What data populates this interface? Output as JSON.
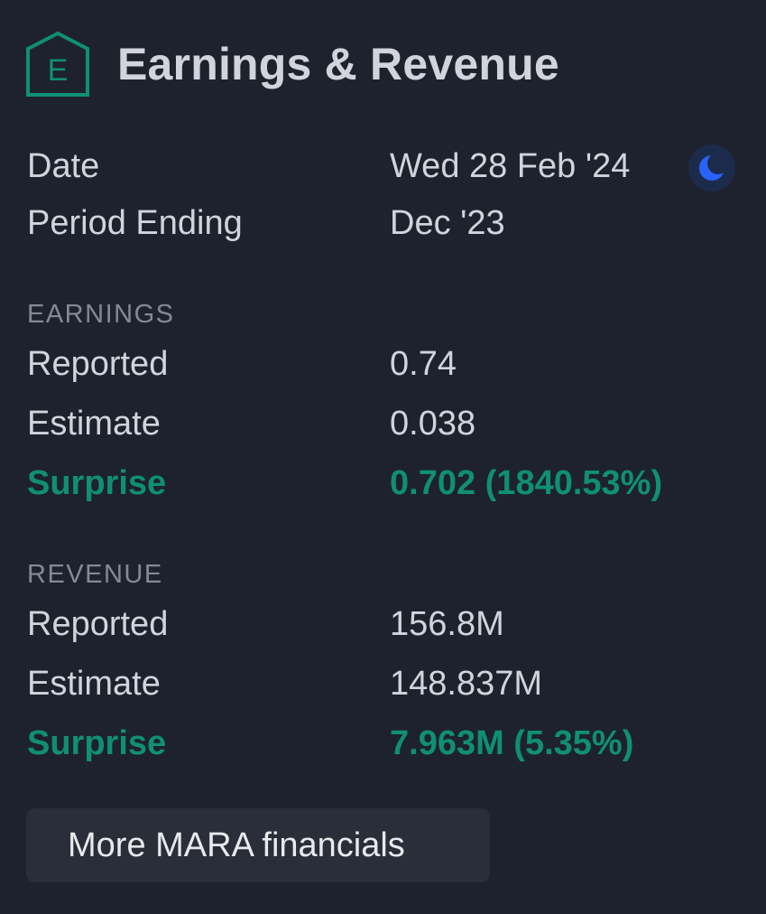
{
  "header": {
    "logo_letter": "E",
    "title": "Earnings & Revenue",
    "accent_color": "#0f8f74"
  },
  "summary": {
    "date_label": "Date",
    "date_value": "Wed 28 Feb '24",
    "date_icon": "moon-icon",
    "period_label": "Period Ending",
    "period_value": "Dec '23"
  },
  "earnings": {
    "section_title": "EARNINGS",
    "reported_label": "Reported",
    "reported_value": "0.74",
    "estimate_label": "Estimate",
    "estimate_value": "0.038",
    "surprise_label": "Surprise",
    "surprise_value": "0.702 (1840.53%)"
  },
  "revenue": {
    "section_title": "REVENUE",
    "reported_label": "Reported",
    "reported_value": "156.8M",
    "estimate_label": "Estimate",
    "estimate_value": "148.837M",
    "surprise_label": "Surprise",
    "surprise_value": "7.963M (5.35%)"
  },
  "actions": {
    "more_button_label": "More MARA financials"
  }
}
